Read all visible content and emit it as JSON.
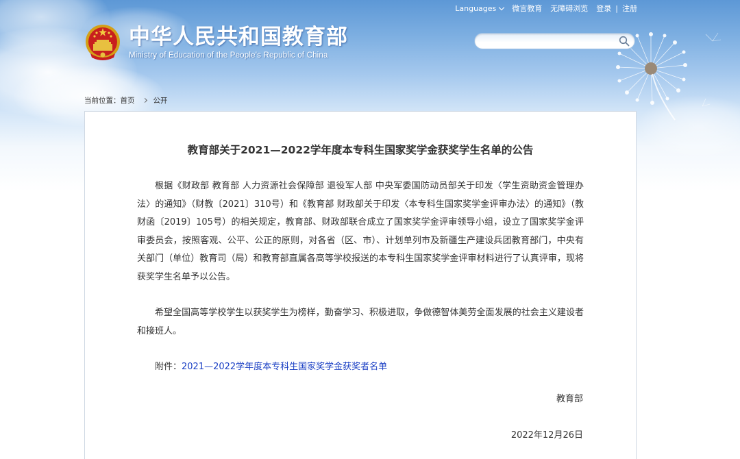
{
  "header": {
    "top_links": {
      "languages": "Languages",
      "weibo": "微言教育",
      "accessibility": "无障碍浏览",
      "login": "登录",
      "separator": "|",
      "register": "注册"
    },
    "logo": {
      "title_cn": "中华人民共和国教育部",
      "title_en": "Ministry of Education of the People's Republic of China"
    },
    "search": {
      "value": "",
      "icon": "search-icon"
    }
  },
  "breadcrumb": {
    "prefix": "当前位置：",
    "home": "首页",
    "current": "公开"
  },
  "article": {
    "title": "教育部关于2021—2022学年度本专科生国家奖学金获奖学生名单的公告",
    "paragraph1": "根据《财政部 教育部 人力资源社会保障部 退役军人部 中央军委国防动员部关于印发〈学生资助资金管理办法〉的通知》（财教〔2021〕310号）和《教育部 财政部关于印发〈本专科生国家奖学金评审办法〉的通知》（教财函〔2019〕105号）的相关规定，教育部、财政部联合成立了国家奖学金评审领导小组，设立了国家奖学金评审委员会，按照客观、公平、公正的原则，对各省（区、市）、计划单列市及新疆生产建设兵团教育部门，中央有关部门（单位）教育司（局）和教育部直属各高等学校报送的本专科生国家奖学金评审材料进行了认真评审，现将获奖学生名单予以公告。",
    "paragraph2": "希望全国高等学校学生以获奖学生为榜样，勤奋学习、积极进取，争做德智体美劳全面发展的社会主义建设者和接班人。",
    "attachment_label": "附件：",
    "attachment_link": "2021—2022学年度本专科生国家奖学金获奖者名单",
    "signature": "教育部",
    "date": "2022年12月26日"
  },
  "colors": {
    "link": "#1a3fc4",
    "sky_top": "#5d98d6",
    "text": "#333333"
  }
}
